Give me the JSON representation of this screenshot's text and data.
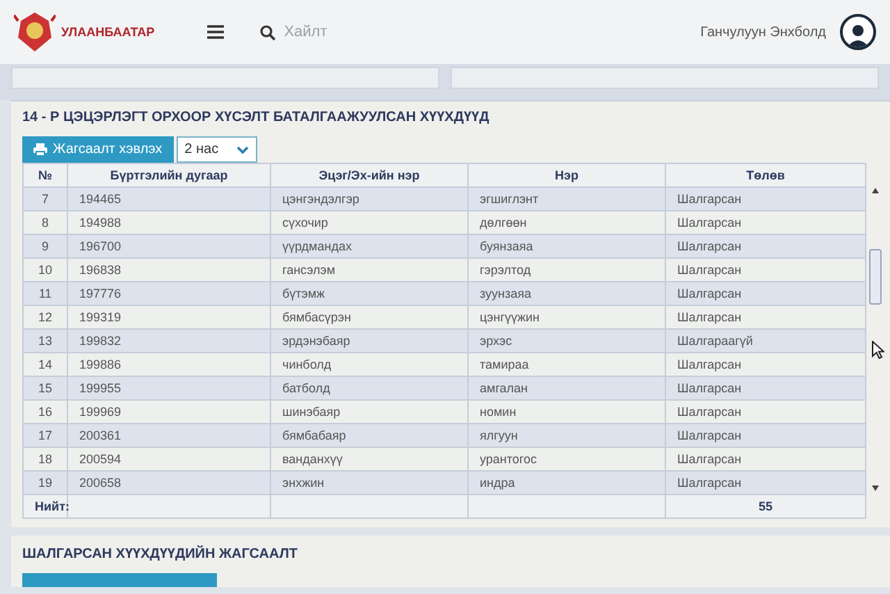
{
  "header": {
    "logo_text": "УЛААНБААТАР",
    "search": {
      "placeholder": "Хайлт"
    },
    "user_name": "Ганчулуун Энхболд"
  },
  "report": {
    "title": "14 - Р ЦЭЦЭРЛЭГТ ОРХООР ХҮСЭЛТ БАТАЛГААЖУУЛСАН ХҮҮХДҮҮД",
    "print_button": "Жагсаалт хэвлэх",
    "age_select": {
      "value": "2 нас"
    },
    "table": {
      "columns": [
        "№",
        "Бүртгэлийн дугаар",
        "Эцэг/Эх-ийн нэр",
        "Нэр",
        "Төлөв"
      ],
      "rows": [
        [
          "7",
          "194465",
          "цэнгэндэлгэр",
          "эгшиглэнт",
          "Шалгарсан"
        ],
        [
          "8",
          "194988",
          "сүхочир",
          "дөлгөөн",
          "Шалгарсан"
        ],
        [
          "9",
          "196700",
          "үүрдмандах",
          "буянзаяа",
          "Шалгарсан"
        ],
        [
          "10",
          "196838",
          "гансэлэм",
          "гэрэлтод",
          "Шалгарсан"
        ],
        [
          "11",
          "197776",
          "бүтэмж",
          "зуунзаяа",
          "Шалгарсан"
        ],
        [
          "12",
          "199319",
          "бямбасүрэн",
          "цэнгүүжин",
          "Шалгарсан"
        ],
        [
          "13",
          "199832",
          "эрдэнэбаяр",
          "эрхэс",
          "Шалгараагүй"
        ],
        [
          "14",
          "199886",
          "чинболд",
          "тамираа",
          "Шалгарсан"
        ],
        [
          "15",
          "199955",
          "батболд",
          "амгалан",
          "Шалгарсан"
        ],
        [
          "16",
          "199969",
          "шинэбаяр",
          "номин",
          "Шалгарсан"
        ],
        [
          "17",
          "200361",
          "бямбабаяр",
          "ялгуун",
          "Шалгарсан"
        ],
        [
          "18",
          "200594",
          "ванданхүү",
          "урантогос",
          "Шалгарсан"
        ],
        [
          "19",
          "200658",
          "энхжин",
          "индра",
          "Шалгарсан"
        ]
      ],
      "footer": {
        "label": "Нийт:",
        "total": "55"
      }
    }
  },
  "second_section": {
    "title": "ШАЛГАРСАН ХҮҮХДҮҮДИЙН ЖАГСААЛТ"
  }
}
